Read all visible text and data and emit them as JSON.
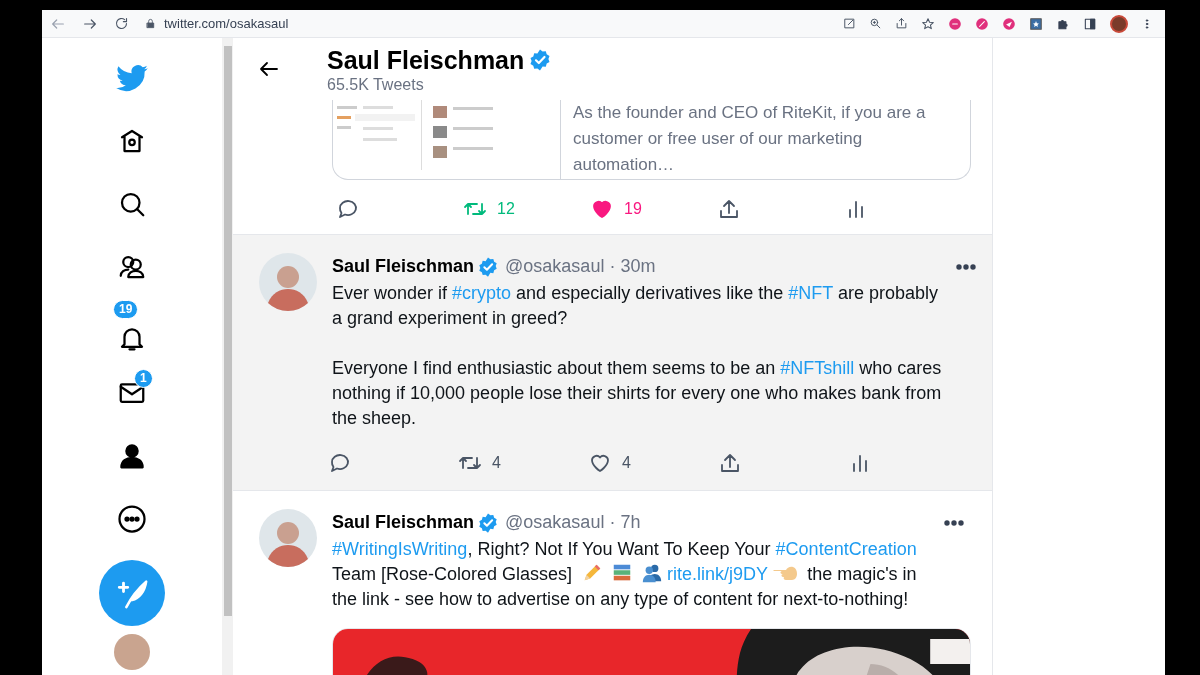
{
  "browser": {
    "url": "twitter.com/osakasaul"
  },
  "nav": [
    {
      "kind": "logo"
    },
    {
      "kind": "home"
    },
    {
      "kind": "explore"
    },
    {
      "kind": "communities"
    },
    {
      "kind": "notifications",
      "badge": "19"
    },
    {
      "kind": "messages",
      "badge": "1"
    },
    {
      "kind": "profile"
    },
    {
      "kind": "more"
    },
    {
      "kind": "compose"
    }
  ],
  "header": {
    "name": "Saul Fleischman",
    "verified": true,
    "count": "65.5K Tweets"
  },
  "tweets": [
    {
      "kind": "partial",
      "hovered": false,
      "card_text": "As the founder and CEO of RiteKit, if you are a customer or free user of our marketing automation…",
      "actions": {
        "retweet": "12",
        "retweeted": true,
        "like": "19",
        "liked": true
      }
    },
    {
      "kind": "full",
      "hovered": true,
      "name": "Saul Fleischman",
      "verified": true,
      "handle": "@osakasaul",
      "time": "· 30m",
      "paragraphs": [
        [
          {
            "kind": "text",
            "text": "Ever wonder if "
          },
          {
            "kind": "link",
            "text": "#crypto"
          },
          {
            "kind": "text",
            "text": " and especially derivatives like the "
          },
          {
            "kind": "link",
            "text": "#NFT"
          },
          {
            "kind": "text",
            "text": " are probably a grand experiment in greed?"
          }
        ],
        [
          {
            "kind": "text",
            "text": "Everyone I find enthusiastic about them seems to be an "
          },
          {
            "kind": "link",
            "text": "#NFTshill"
          },
          {
            "kind": "text",
            "text": " who cares nothing if 10,000 people lose their shirts for every one who makes bank from the sheep."
          }
        ]
      ],
      "actions": {
        "retweet": "4",
        "retweeted": false,
        "like": "4",
        "liked": false
      }
    },
    {
      "kind": "full",
      "hovered": false,
      "name": "Saul Fleischman",
      "verified": true,
      "handle": "@osakasaul",
      "time": "· 7h",
      "media": true,
      "paragraphs": [
        [
          {
            "kind": "link",
            "text": "#WritingIsWriting"
          },
          {
            "kind": "text",
            "text": ", Right? Not If You Want To Keep Your "
          },
          {
            "kind": "link",
            "text": "#ContentCreation"
          },
          {
            "kind": "text",
            "text": " Team [Rose-Colored Glasses] "
          },
          {
            "kind": "emoji"
          },
          {
            "kind": "emoji"
          },
          {
            "kind": "emoji"
          },
          {
            "kind": "link",
            "text": "rite.link/j9DY"
          },
          {
            "kind": "emoji"
          },
          {
            "kind": "text",
            "text": " the magic's in the link - see how to advertise on any type of content for next-to-nothing!"
          }
        ]
      ]
    }
  ]
}
